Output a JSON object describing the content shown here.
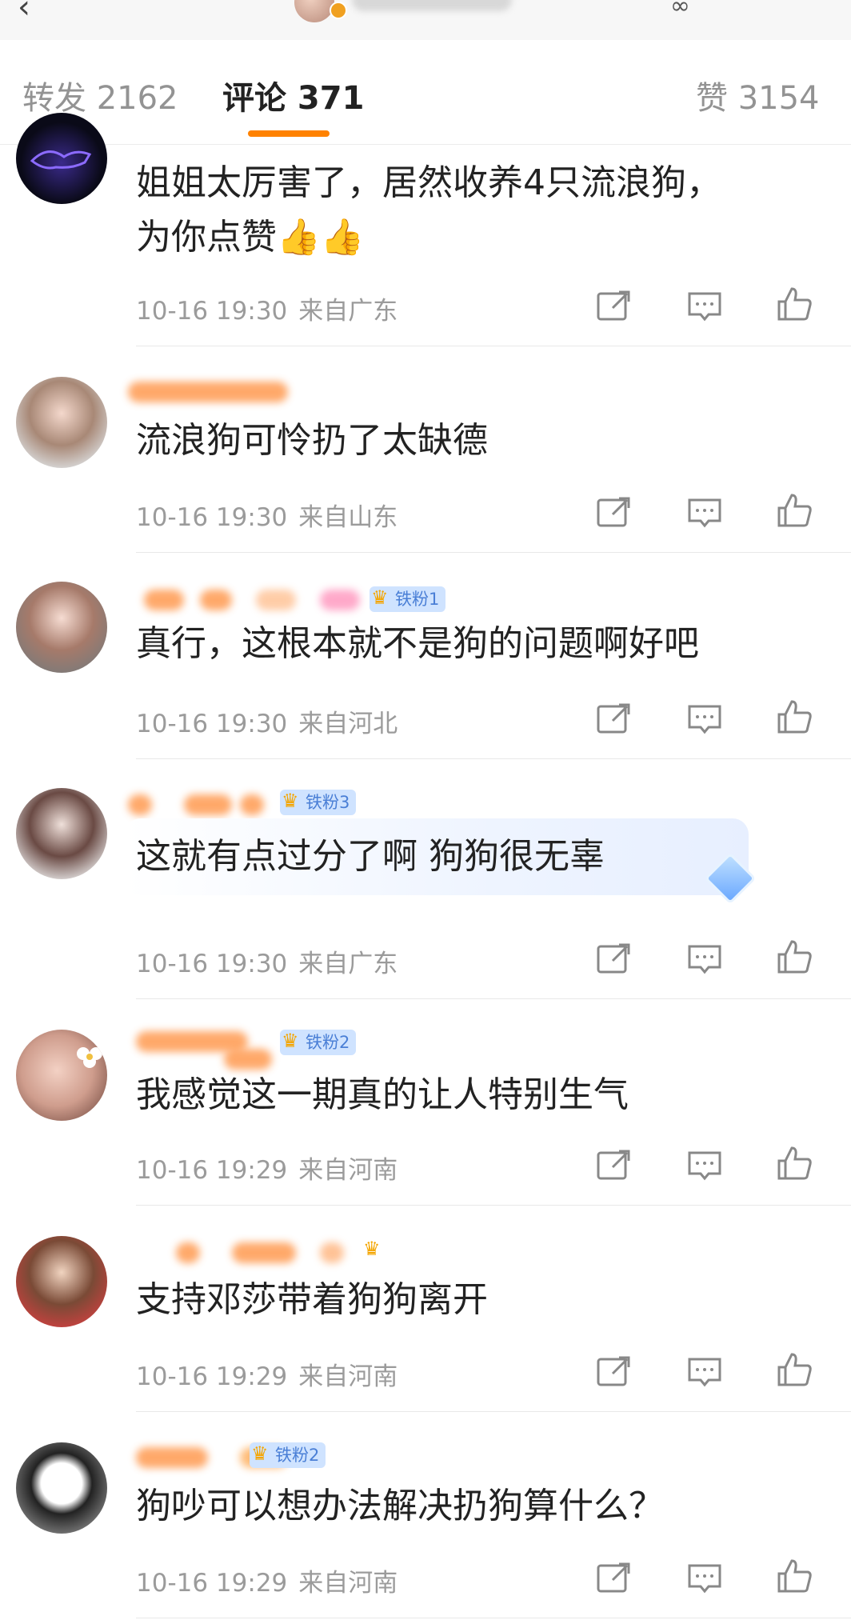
{
  "tabs": {
    "repost": "转发 2162",
    "comments": "评论 371",
    "likes": "赞 3154"
  },
  "accent_color": "#ff8200",
  "comments": [
    {
      "text_line1": "姐姐太厉害了，居然收养4只流浪狗，",
      "text_line2": "为你点赞👍👍",
      "time": "10-16 19:30",
      "location": "来自广东"
    },
    {
      "text": "流浪狗可怜扔了太缺德",
      "time": "10-16 19:30",
      "location": "来自山东"
    },
    {
      "badge": "铁粉1",
      "text": "真行，这根本就不是狗的问题啊好吧",
      "time": "10-16 19:30",
      "location": "来自河北"
    },
    {
      "badge": "铁粉3",
      "text": "这就有点过分了啊 狗狗很无辜",
      "time": "10-16 19:30",
      "location": "来自广东"
    },
    {
      "badge": "铁粉2",
      "text": "我感觉这一期真的让人特别生气",
      "time": "10-16 19:29",
      "location": "来自河南"
    },
    {
      "text": "支持邓莎带着狗狗离开",
      "time": "10-16 19:29",
      "location": "来自河南"
    },
    {
      "badge": "铁粉2",
      "text": "狗吵可以想办法解决扔狗算什么？",
      "time": "10-16 19:29",
      "location": "来自河南"
    }
  ]
}
